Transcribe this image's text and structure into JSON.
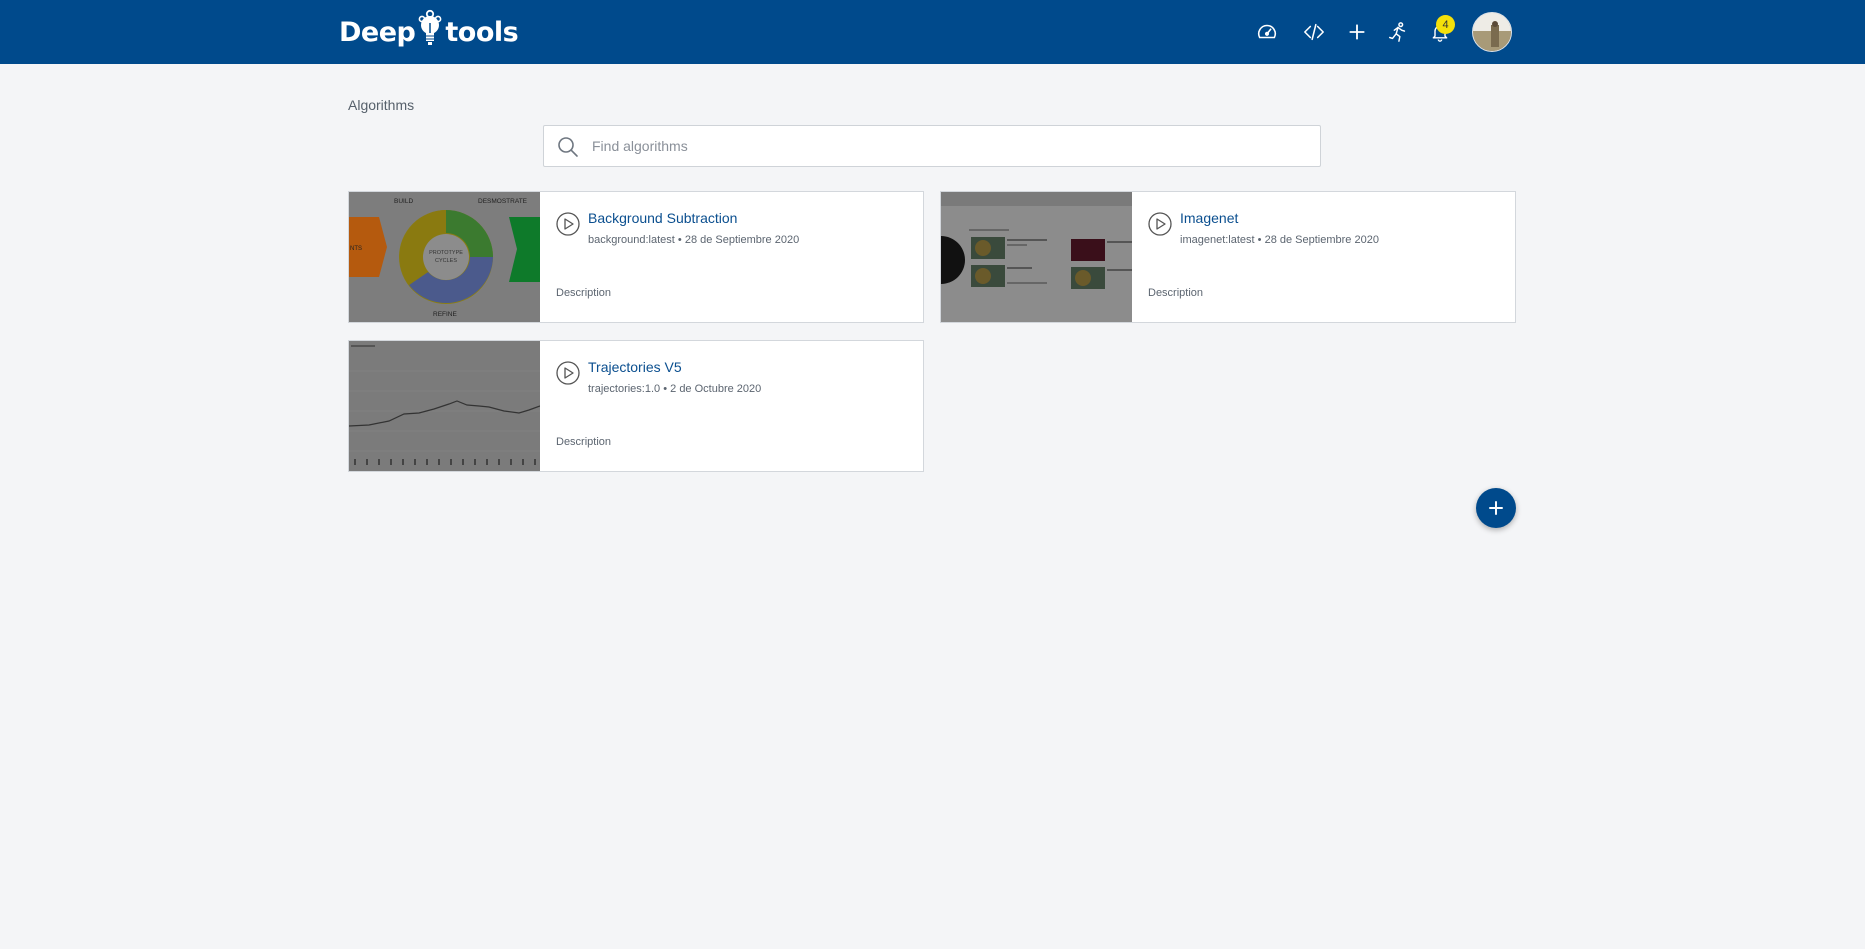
{
  "header": {
    "logo_left": "Deep",
    "logo_right": "tools",
    "notifications_count": "4",
    "icons": [
      "dashboard-icon",
      "code-icon",
      "add-icon",
      "run-icon",
      "bell-icon"
    ]
  },
  "breadcrumb": "Algorithms",
  "search": {
    "placeholder": "Find algorithms",
    "value": ""
  },
  "cards": [
    {
      "title": "Background Subtraction",
      "image": "background:latest",
      "date": "28 de Septiembre 2020",
      "description": "Description",
      "thumbnail_labels": [
        "BUILD",
        "DESMOSTRATE",
        "PROTOTYPE",
        "CYCLES",
        "REFINE",
        "NTS"
      ]
    },
    {
      "title": "Imagenet",
      "image": "imagenet:latest",
      "date": "28 de Septiembre 2020",
      "description": "Description"
    },
    {
      "title": "Trajectories V5",
      "image": "trajectories:1.0",
      "date": "2 de Octubre 2020",
      "description": "Description"
    }
  ],
  "colors": {
    "brand": "#004a8c",
    "badge": "#f5e10a",
    "link": "#0b4f8f"
  }
}
